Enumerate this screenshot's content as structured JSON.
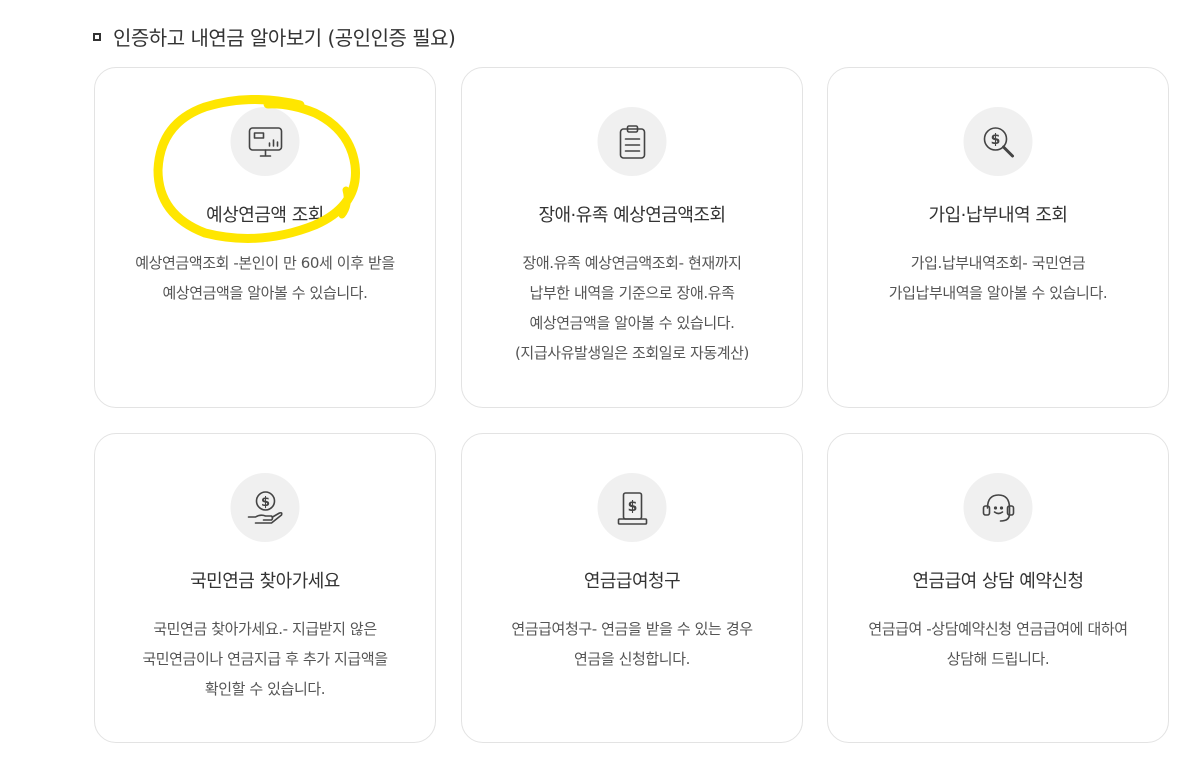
{
  "section": {
    "title": "인증하고 내연금 알아보기 (공인인증 필요)"
  },
  "cards": [
    {
      "title": "예상연금액 조회",
      "desc": "예상연금액조회 -본인이 만 60세 이후 받을\n예상연금액을 알아볼 수 있습니다.",
      "icon": "monitor-chart-icon"
    },
    {
      "title": "장애·유족 예상연금액조회",
      "desc": "장애.유족 예상연금액조회- 현재까지\n납부한 내역을 기준으로 장애.유족\n예상연금액을 알아볼 수 있습니다.\n(지급사유발생일은 조회일로 자동계산)",
      "icon": "clipboard-icon"
    },
    {
      "title": "가입·납부내역 조회",
      "desc": "가입.납부내역조회- 국민연금\n가입납부내역을 알아볼 수 있습니다.",
      "icon": "dollar-magnifier-icon"
    },
    {
      "title": "국민연금 찾아가세요",
      "desc": "국민연금 찾아가세요.- 지급받지 않은\n국민연금이나 연금지급 후 추가 지급액을\n확인할 수 있습니다.",
      "icon": "hand-coin-icon"
    },
    {
      "title": "연금급여청구",
      "desc": "연금급여청구- 연금을 받을 수 있는 경우\n연금을 신청합니다.",
      "icon": "dollar-document-icon"
    },
    {
      "title": "연금급여 상담 예약신청",
      "desc": "연금급여 -상담예약신청 연금급여에 대하여\n상담해 드립니다.",
      "icon": "headset-icon"
    }
  ],
  "colors": {
    "highlight": "#ffe600",
    "border": "#e3e3e3",
    "icon_bg": "#f0f0f0"
  }
}
